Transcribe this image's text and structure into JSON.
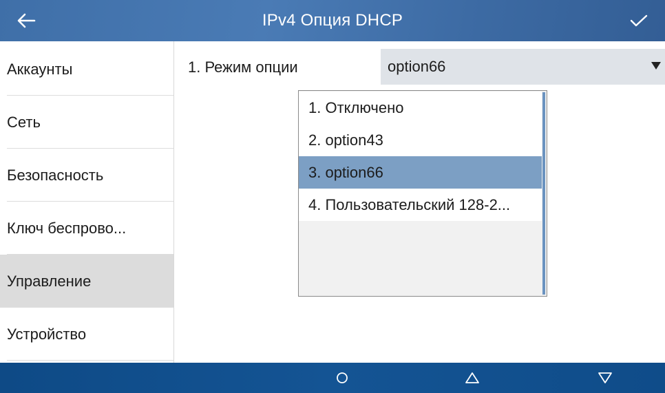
{
  "header": {
    "title": "IPv4 Опция DHCP",
    "back_icon": "arrow-left-icon",
    "confirm_icon": "checkmark-icon"
  },
  "sidebar": {
    "items": [
      {
        "label": "Аккаунты"
      },
      {
        "label": "Сеть"
      },
      {
        "label": "Безопасность"
      },
      {
        "label": "Ключ беспрово..."
      },
      {
        "label": "Управление",
        "active": true
      },
      {
        "label": "Устройство"
      }
    ]
  },
  "main": {
    "option_label": "1. Режим опции",
    "select_value": "option66",
    "dropdown": {
      "options": [
        {
          "label": "1. Отключено"
        },
        {
          "label": "2. option43"
        },
        {
          "label": "3. option66",
          "selected": true
        },
        {
          "label": "4. Пользовательский 128-2..."
        }
      ]
    }
  },
  "footer": {
    "icons": [
      "circle-home-icon",
      "triangle-up-icon",
      "triangle-down-icon"
    ]
  },
  "colors": {
    "header": "#3f6fa8",
    "footer": "#0e4a86",
    "active_item": "#dcdcdc",
    "selected_option": "#7c9fc4"
  }
}
